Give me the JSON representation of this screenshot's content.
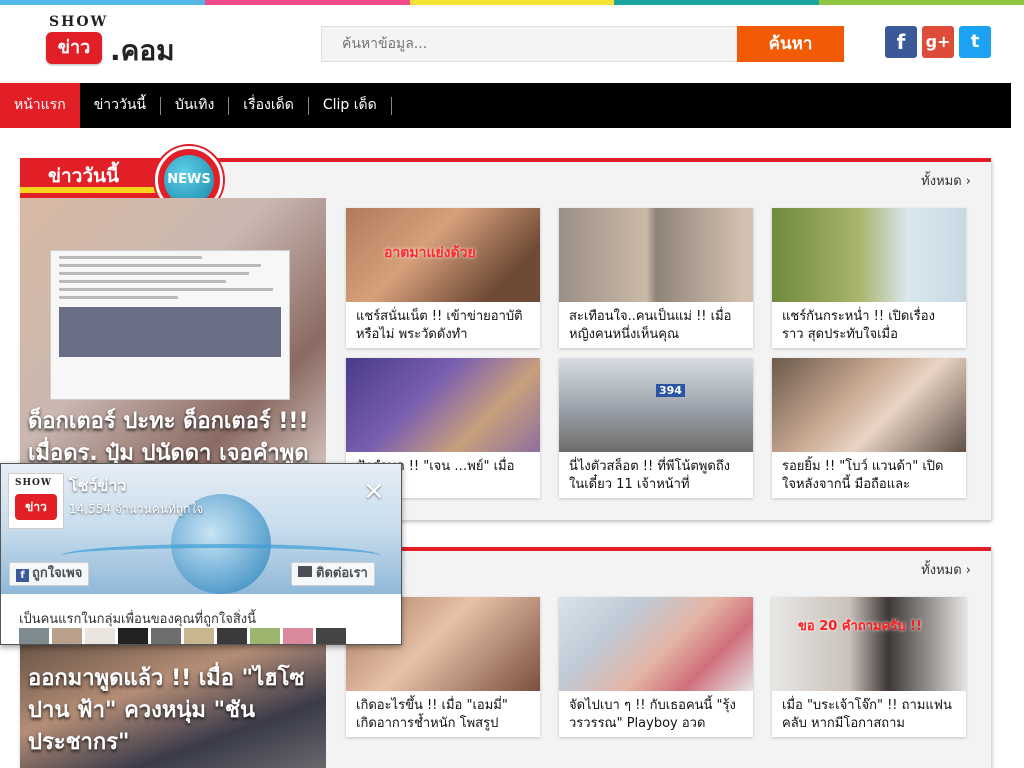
{
  "topbar_colors": [
    "#55b7e8",
    "#ee4a8c",
    "#f5e132",
    "#1aa69f",
    "#8ec63f"
  ],
  "brand": {
    "show": "SHOW",
    "khao": "ข่าว",
    "dotcom": ".คอม",
    "accent": "#e21e26"
  },
  "search": {
    "placeholder": "ค้นหาข้อมูล...",
    "button": "ค้นหา",
    "button_color": "#f25a05"
  },
  "social": {
    "facebook": "f",
    "googleplus": "g+",
    "twitter": "t"
  },
  "nav": {
    "items": [
      {
        "label": "หน้าแรก",
        "active": true
      },
      {
        "label": "ข่าววันนี้"
      },
      {
        "label": "บันเทิง"
      },
      {
        "label": "เรื่องเด็ด"
      },
      {
        "label": "Clip เด็ด"
      }
    ]
  },
  "section1": {
    "label": "ข่าววันนี้",
    "badge": "NEWS",
    "see_all": "ทั้งหมด",
    "feature_title": "ด็อกเตอร์ ปะทะ ด็อกเตอร์ !!! เมื่อดร. ปุ๋ม ปนัดดา เจอคำพูด แบบนี้ ถึงกับเดือด ตอกกลับ",
    "cards": [
      {
        "title": "แชร์สนั่นเน็ต !! เข้าข่ายอาบัติหรือไม่ พระวัดดังทำ",
        "image_text": "อาตมาแย่งด้วย"
      },
      {
        "title": "สะเทือนใจ..คนเป็นแม่ !! เมื่อหญิงคนหนึ่งเห็นคุณ"
      },
      {
        "title": "แชร์กันกระหน่ำ !! เปิดเรื่องราว สุดประทับใจเมื่อ"
      },
      {
        "title": "ฟังคำพูด !! \"เจน …พย์\" เมื่อเธอออก"
      },
      {
        "title": "นี่ไงตัวสล็อต !! ที่พีโน้ตพูดถึงในเดี๋ยว 11 เจ้าหน้าที่",
        "image_text": "394"
      },
      {
        "title": "รอยยิ้ม !! \"โบว์ แวนด้า\" เปิดใจหลังจากนี้ มือถือและ"
      }
    ]
  },
  "section2": {
    "see_all": "ทั้งหมด",
    "feature_title": "ออกมาพูดแล้ว !! เมื่อ \"ไฮโซปาน ฟ้า\" ควงหนุ่ม \"ชัน ประชากร\"",
    "cards": [
      {
        "title": "เกิดอะไรขึ้น !! เมื่อ \"เอมมี่\" เกิดอาการช้ำหนัก โพสรูป"
      },
      {
        "title": "จัดไปเบา ๆ !! กับเธอคนนี้ \"รุ้ง วรวรรณ\" Playboy อวด"
      },
      {
        "title": "เมื่อ \"บระเจ้าโจ๊ก\" !! ถามแฟนคลับ หากมีโอกาสถาม",
        "image_text": "ขอ 20 คำถามครับ !!"
      }
    ]
  },
  "fb_popup": {
    "page_name": "โชว์ข่าว",
    "likes": "14,554 จำนวนคนที่ถูกใจ",
    "close": "×",
    "like_button": "ถูกใจเพจ",
    "message_button": "ติดต่อเรา",
    "friends_text": "เป็นคนแรกในกลุ่มเพื่อนของคุณที่ถูกใจสิ่งนี้",
    "avatar_show": "SHOW",
    "avatar_khao": "ข่าว"
  }
}
